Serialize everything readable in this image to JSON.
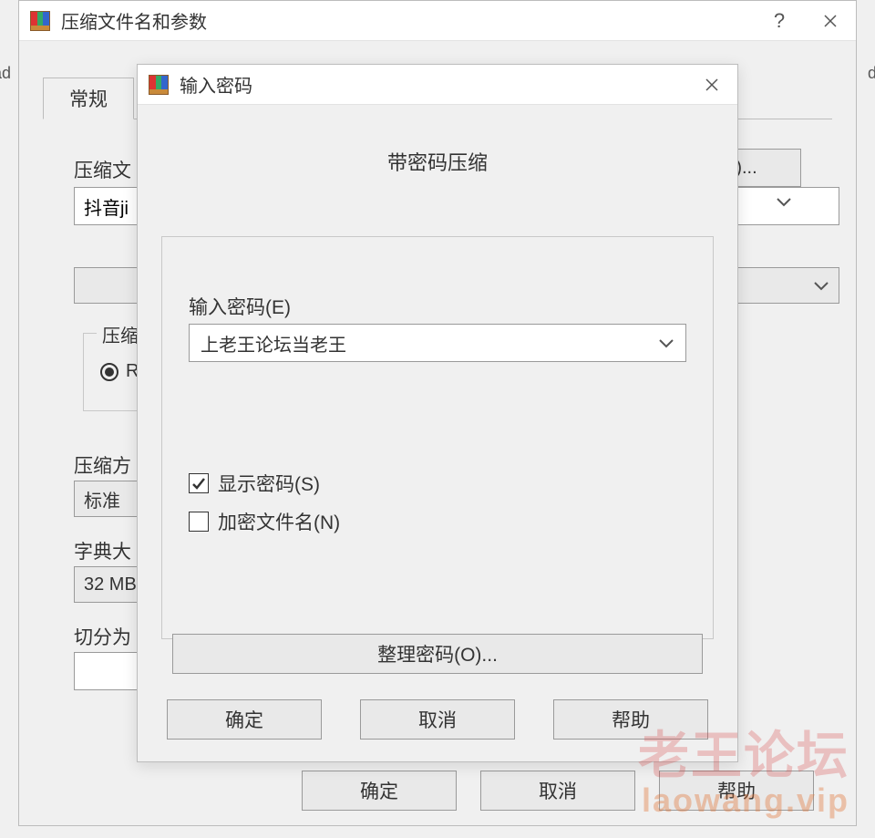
{
  "bg": {
    "left": "ad",
    "right": "di"
  },
  "main": {
    "title": "压缩文件名和参数",
    "help_glyph": "?",
    "tab_general": "常规",
    "filename_label": "压缩文",
    "filename_value": "抖音ji",
    "browse_label": "(B)...",
    "format_legend": "压缩",
    "format_rar": "RA",
    "method_label": "压缩方",
    "method_value": "标准",
    "dict_label": "字典大",
    "dict_value": "32 MB",
    "split_label": "切分为",
    "btn_ok": "确定",
    "btn_cancel": "取消",
    "btn_help": "帮助"
  },
  "pwd": {
    "title": "输入密码",
    "heading": "带密码压缩",
    "input_label": "输入密码(E)",
    "input_value": "上老王论坛当老王",
    "show_password": "显示密码(S)",
    "show_password_checked": true,
    "encrypt_names": "加密文件名(N)",
    "encrypt_names_checked": false,
    "organize": "整理密码(O)...",
    "btn_ok": "确定",
    "btn_cancel": "取消",
    "btn_help": "帮助"
  },
  "watermark": {
    "line1": "老王论坛",
    "line2": "laowang.vip"
  }
}
